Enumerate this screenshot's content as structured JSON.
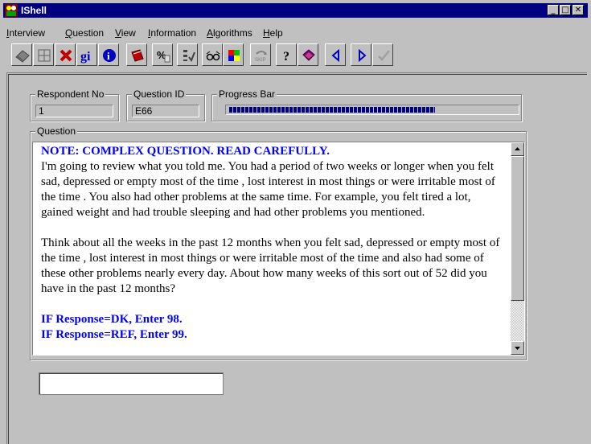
{
  "window": {
    "title": "IShell",
    "controls": {
      "minimize": "_",
      "maximize": "□",
      "close": "✕"
    }
  },
  "menu": [
    {
      "label": "Interview",
      "mnemonic": "I"
    },
    {
      "label": "Question",
      "mnemonic": "Q"
    },
    {
      "label": "View",
      "mnemonic": "V"
    },
    {
      "label": "Information",
      "mnemonic": "I"
    },
    {
      "label": "Algorithms",
      "mnemonic": "A"
    },
    {
      "label": "Help",
      "mnemonic": "H"
    }
  ],
  "toolbar": {
    "buttons": [
      {
        "icon": "eraser-icon"
      },
      {
        "icon": "grid-book-icon"
      },
      {
        "icon": "red-x-icon"
      },
      {
        "icon": "gi-text",
        "text": "gi"
      },
      {
        "icon": "info-icon",
        "text": "i"
      },
      {
        "icon": "red-book-icon"
      },
      {
        "icon": "percent-icon",
        "text": "%"
      },
      {
        "icon": "checklist-icon"
      },
      {
        "icon": "glasses-icon"
      },
      {
        "icon": "color-grid-icon"
      },
      {
        "icon": "skip-icon",
        "text": "SKIP"
      },
      {
        "icon": "help-question-icon",
        "text": "?"
      },
      {
        "icon": "purple-book-icon"
      },
      {
        "icon": "previous-arrow-icon"
      },
      {
        "icon": "next-arrow-icon"
      },
      {
        "icon": "check-icon"
      }
    ]
  },
  "fields": {
    "respondent_label": "Respondent No",
    "respondent_value": "1",
    "question_id_label": "Question ID",
    "question_id_value": "E66",
    "progress_label": "Progress Bar",
    "progress_fraction": 0.72
  },
  "question": {
    "group_label": "Question",
    "note": "NOTE: COMPLEX QUESTION. READ CAREFULLY.",
    "paragraph1": "I'm going to review what you told me.  You had a period of two weeks or longer when you felt sad, depressed or empty most of the time , lost interest in most things or were irritable most of the time .  You also had other problems at the same time.  For example, you   felt tired a lot, gained weight and had trouble sleeping and had other problems you mentioned.",
    "paragraph2": "Think about all the weeks in the past 12 months when you felt sad, depressed or empty most of the time , lost interest in most things or were irritable most of the time and also had some of these other problems nearly every day.  About how many weeks of this sort out of 52 did you have in the past 12 months?",
    "instruction1": "IF Response=DK, Enter 98.",
    "instruction2": "IF Response=REF, Enter 99."
  },
  "answer": {
    "value": ""
  },
  "colors": {
    "titlebar": "#000080",
    "note_text": "#0000ff",
    "window_bg": "#c0c0c0"
  }
}
